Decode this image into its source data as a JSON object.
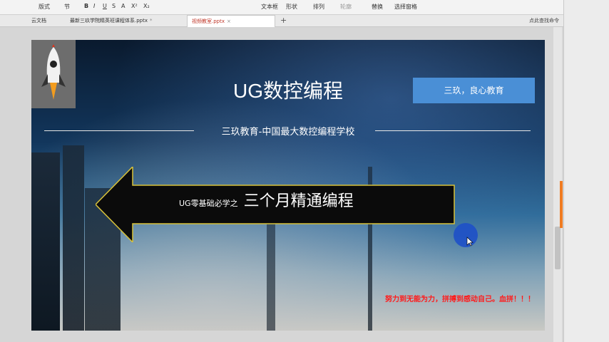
{
  "toolbar": {
    "items": [
      "版式",
      "节",
      "B",
      "I",
      "U",
      "S",
      "A",
      "X²",
      "X₂",
      "文本框",
      "形状",
      "排列",
      "轮廓",
      "替换",
      "选择窗格"
    ]
  },
  "tabs": [
    {
      "label": "云文档",
      "close": ""
    },
    {
      "label": "最新三玖学院精英班课程体系.pptx",
      "close": "*"
    },
    {
      "label": "视频教室.pptx",
      "close": "×"
    }
  ],
  "right_tools": [
    "点此查找命令"
  ],
  "slide": {
    "title": "UG数控编程",
    "badge": "三玖，良心教育",
    "subtitle": "三玖教育-中国最大数控编程学校",
    "arrow_small": "UG零基础必学之",
    "arrow_big": "三个月精通编程",
    "motto": "努力到无能为力，拼搏到感动自己。血拼！！！"
  }
}
